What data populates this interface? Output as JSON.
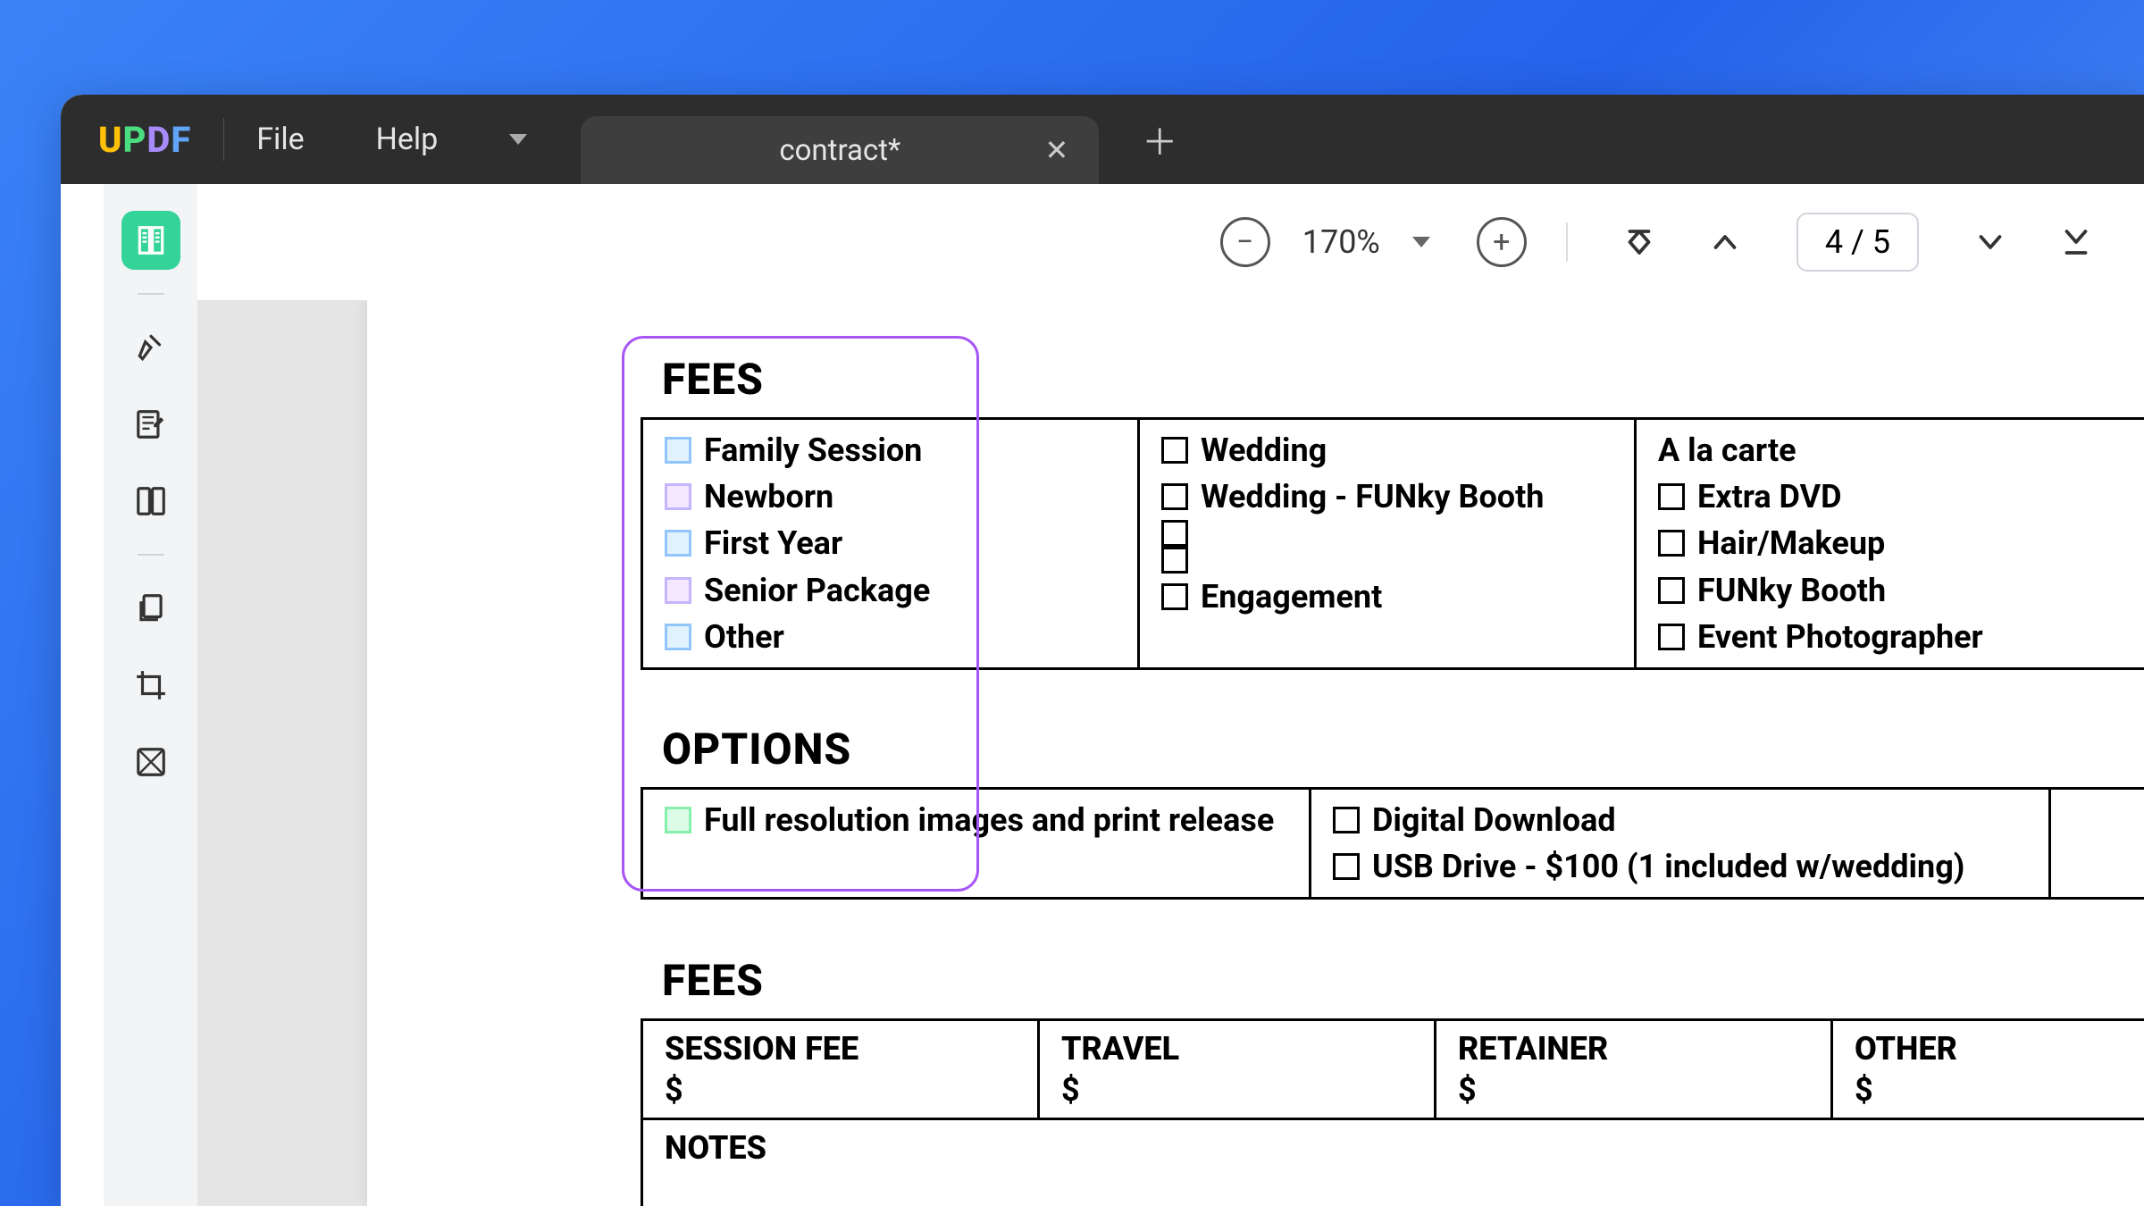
{
  "app": {
    "logo": "UPDF"
  },
  "menu": {
    "file": "File",
    "help": "Help"
  },
  "tab": {
    "title": "contract*"
  },
  "toolbar": {
    "zoom": "170%",
    "page_indicator": "4 / 5"
  },
  "document": {
    "fees": {
      "title": "FEES",
      "col1": [
        {
          "label": "Family Session",
          "style": "blue"
        },
        {
          "label": "Newborn",
          "style": "purple"
        },
        {
          "label": "First Year",
          "style": "blue"
        },
        {
          "label": "Senior Package",
          "style": "purple"
        },
        {
          "label": "Other",
          "style": "blue"
        }
      ],
      "col2": [
        {
          "label": "Wedding"
        },
        {
          "label": "Wedding - FUNky Booth"
        },
        {
          "label": ""
        },
        {
          "label": ""
        },
        {
          "label": "Engagement"
        }
      ],
      "col3_header": "A la carte",
      "col3": [
        {
          "label": "Extra DVD"
        },
        {
          "label": "Hair/Makeup"
        },
        {
          "label": "FUNky Booth"
        },
        {
          "label": "Event Photographer"
        }
      ]
    },
    "options": {
      "title": "OPTIONS",
      "col1": [
        {
          "label": "Full resolution images and print release",
          "style": "green"
        }
      ],
      "col2": [
        {
          "label": "Digital Download"
        },
        {
          "label": "USB Drive - $100 (1 included w/wedding)"
        }
      ]
    },
    "fees2": {
      "title": "FEES",
      "columns": [
        {
          "label": "SESSION FEE",
          "value": "$"
        },
        {
          "label": "TRAVEL",
          "value": "$"
        },
        {
          "label": "RETAINER",
          "value": "$"
        },
        {
          "label": "OTHER",
          "value": "$"
        }
      ],
      "notes_label": "NOTES"
    }
  }
}
